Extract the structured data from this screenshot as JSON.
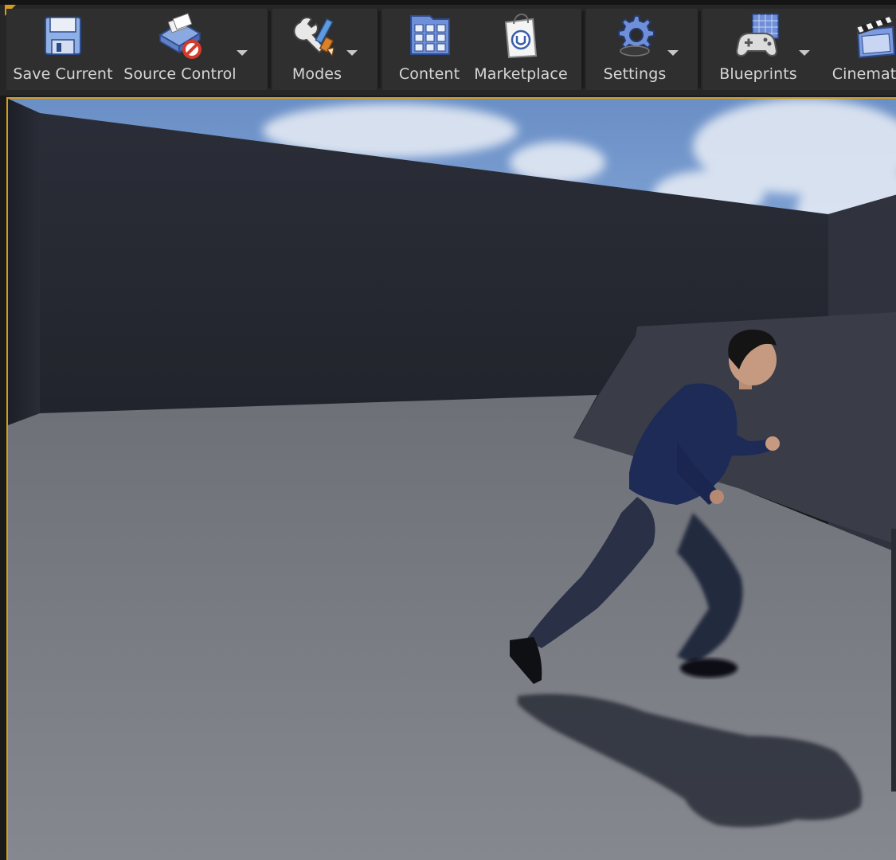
{
  "toolbar": {
    "buttons": [
      {
        "id": "save-current",
        "label": "Save Current",
        "icon": "floppy-disk-icon"
      },
      {
        "id": "source-control",
        "label": "Source Control",
        "icon": "source-control-disabled-icon"
      },
      {
        "id": "modes",
        "label": "Modes",
        "icon": "wrench-brush-icon"
      },
      {
        "id": "content",
        "label": "Content",
        "icon": "content-grid-icon"
      },
      {
        "id": "marketplace",
        "label": "Marketplace",
        "icon": "shopping-bag-icon"
      },
      {
        "id": "settings",
        "label": "Settings",
        "icon": "gear-icon"
      },
      {
        "id": "blueprints",
        "label": "Blueprints",
        "icon": "gamepad-blueprint-icon"
      },
      {
        "id": "cinematics",
        "label": "Cinematics",
        "icon": "clapperboard-icon"
      }
    ]
  },
  "viewport": {
    "scene": "level viewport",
    "colors": {
      "accent_border": "#d29c1e",
      "wall": "#2a2c35",
      "floor": "#7d7f86",
      "sky": "#6f93c8"
    }
  }
}
